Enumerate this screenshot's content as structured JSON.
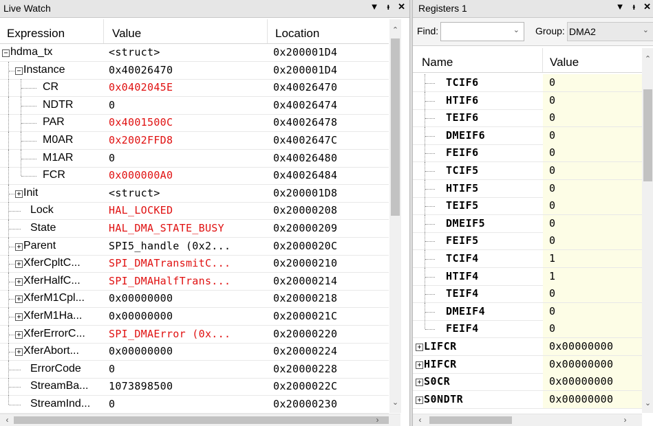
{
  "live_watch": {
    "title": "Live Watch",
    "header": {
      "expression": "Expression",
      "value": "Value",
      "location": "Location"
    },
    "rows": [
      {
        "name": "hdma_tx",
        "value": "<struct>",
        "location": "0x200001D4",
        "level": 0,
        "expander": "minus",
        "red": false
      },
      {
        "name": "Instance",
        "value": "0x40026470",
        "location": "0x200001D4",
        "level": 1,
        "expander": "minus",
        "red": false
      },
      {
        "name": "CR",
        "value": "0x0402045E",
        "location": "0x40026470",
        "level": 2,
        "expander": "none",
        "red": true
      },
      {
        "name": "NDTR",
        "value": "0",
        "location": "0x40026474",
        "level": 2,
        "expander": "none",
        "red": false
      },
      {
        "name": "PAR",
        "value": "0x4001500C",
        "location": "0x40026478",
        "level": 2,
        "expander": "none",
        "red": true
      },
      {
        "name": "M0AR",
        "value": "0x2002FFD8",
        "location": "0x4002647C",
        "level": 2,
        "expander": "none",
        "red": true
      },
      {
        "name": "M1AR",
        "value": "0",
        "location": "0x40026480",
        "level": 2,
        "expander": "none",
        "red": false
      },
      {
        "name": "FCR",
        "value": "0x000000A0",
        "location": "0x40026484",
        "level": 2,
        "expander": "none",
        "red": true
      },
      {
        "name": "Init",
        "value": "<struct>",
        "location": "0x200001D8",
        "level": 1,
        "expander": "plus",
        "red": false
      },
      {
        "name": "Lock",
        "value": "HAL_LOCKED",
        "location": "0x20000208",
        "level": 1,
        "expander": "none",
        "red": true
      },
      {
        "name": "State",
        "value": "HAL_DMA_STATE_BUSY",
        "location": "0x20000209",
        "level": 1,
        "expander": "none",
        "red": true
      },
      {
        "name": "Parent",
        "value": "SPI5_handle (0x2...",
        "location": "0x2000020C",
        "level": 1,
        "expander": "plus",
        "red": false
      },
      {
        "name": "XferCpltC...",
        "value": "SPI_DMATransmitC...",
        "location": "0x20000210",
        "level": 1,
        "expander": "plus",
        "red": true
      },
      {
        "name": "XferHalfC...",
        "value": "SPI_DMAHalfTrans...",
        "location": "0x20000214",
        "level": 1,
        "expander": "plus",
        "red": true
      },
      {
        "name": "XferM1Cpl...",
        "value": "0x00000000",
        "location": "0x20000218",
        "level": 1,
        "expander": "plus",
        "red": false
      },
      {
        "name": "XferM1Ha...",
        "value": "0x00000000",
        "location": "0x2000021C",
        "level": 1,
        "expander": "plus",
        "red": false
      },
      {
        "name": "XferErrorC...",
        "value": "SPI_DMAError (0x...",
        "location": "0x20000220",
        "level": 1,
        "expander": "plus",
        "red": true
      },
      {
        "name": "XferAbort...",
        "value": "0x00000000",
        "location": "0x20000224",
        "level": 1,
        "expander": "plus",
        "red": false
      },
      {
        "name": "ErrorCode",
        "value": "0",
        "location": "0x20000228",
        "level": 1,
        "expander": "none",
        "red": false
      },
      {
        "name": "StreamBa...",
        "value": "1073898500",
        "location": "0x2000022C",
        "level": 1,
        "expander": "none",
        "red": false
      },
      {
        "name": "StreamInd...",
        "value": "0",
        "location": "0x20000230",
        "level": 1,
        "expander": "none",
        "red": false
      }
    ]
  },
  "registers": {
    "title": "Registers 1",
    "find_label": "Find:",
    "find_value": "",
    "group_label": "Group:",
    "group_value": "DMA2",
    "header": {
      "name": "Name",
      "value": "Value"
    },
    "rows": [
      {
        "name": "TCIF6",
        "value": "0",
        "child": true
      },
      {
        "name": "HTIF6",
        "value": "0",
        "child": true
      },
      {
        "name": "TEIF6",
        "value": "0",
        "child": true
      },
      {
        "name": "DMEIF6",
        "value": "0",
        "child": true
      },
      {
        "name": "FEIF6",
        "value": "0",
        "child": true
      },
      {
        "name": "TCIF5",
        "value": "0",
        "child": true
      },
      {
        "name": "HTIF5",
        "value": "0",
        "child": true
      },
      {
        "name": "TEIF5",
        "value": "0",
        "child": true
      },
      {
        "name": "DMEIF5",
        "value": "0",
        "child": true
      },
      {
        "name": "FEIF5",
        "value": "0",
        "child": true
      },
      {
        "name": "TCIF4",
        "value": "1",
        "child": true
      },
      {
        "name": "HTIF4",
        "value": "1",
        "child": true
      },
      {
        "name": "TEIF4",
        "value": "0",
        "child": true
      },
      {
        "name": "DMEIF4",
        "value": "0",
        "child": true
      },
      {
        "name": "FEIF4",
        "value": "0",
        "child": true
      },
      {
        "name": "LIFCR",
        "value": "0x00000000",
        "child": false
      },
      {
        "name": "HIFCR",
        "value": "0x00000000",
        "child": false
      },
      {
        "name": "S0CR",
        "value": "0x00000000",
        "child": false
      },
      {
        "name": "S0NDTR",
        "value": "0x00000000",
        "child": false
      }
    ]
  },
  "icons": {
    "dropdown": "chevron-down-icon",
    "pin": "pin-icon",
    "close": "close-icon"
  },
  "colors": {
    "changed_value": "#e01010",
    "register_value_bg": "#fdfde6"
  }
}
